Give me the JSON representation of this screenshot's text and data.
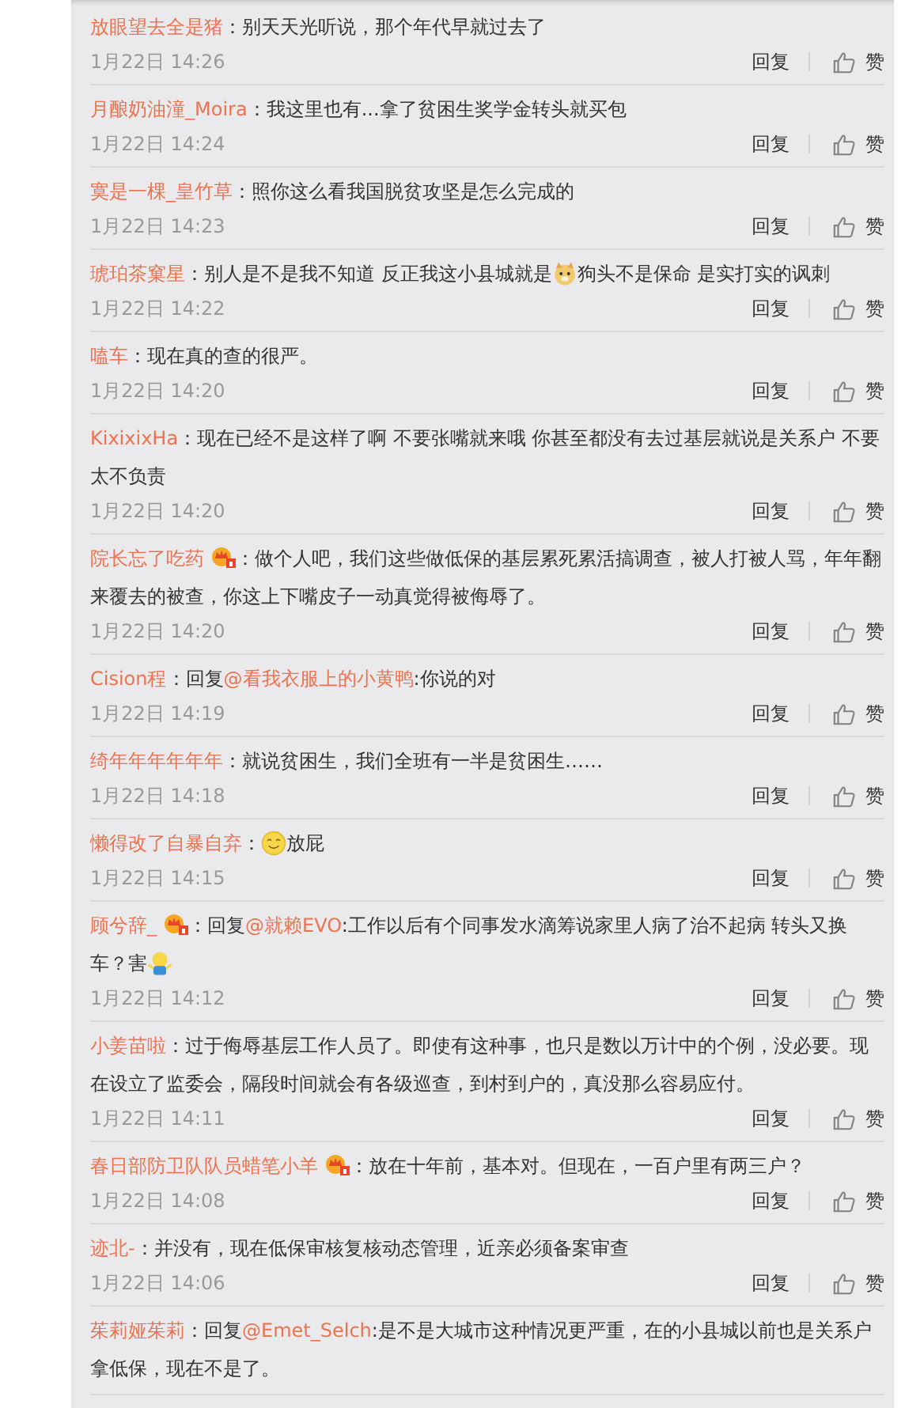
{
  "sep": "：",
  "comments": [
    {
      "name": "放眼望去全是猪",
      "badge": false,
      "content": [
        {
          "kind": "text",
          "text": "别天天光听说，那个年代早就过去了"
        }
      ],
      "time": "1月22日 14:26",
      "reply": "回复",
      "like": "赞"
    },
    {
      "name": "月酿奶油潼_Moira",
      "badge": false,
      "content": [
        {
          "kind": "text",
          "text": "我这里也有...拿了贫困生奖学金转头就买包"
        }
      ],
      "time": "1月22日 14:24",
      "reply": "回复",
      "like": "赞"
    },
    {
      "name": "寞是一棵_皇竹草",
      "badge": false,
      "content": [
        {
          "kind": "text",
          "text": "照你这么看我国脱贫攻坚是怎么完成的"
        }
      ],
      "time": "1月22日 14:23",
      "reply": "回复",
      "like": "赞"
    },
    {
      "name": "琥珀茶窠星",
      "badge": false,
      "content": [
        {
          "kind": "text",
          "text": "别人是不是我不知道 反正我这小县城就是"
        },
        {
          "kind": "dog_emoji"
        },
        {
          "kind": "text",
          "text": "狗头不是保命 是实打实的讽刺"
        }
      ],
      "time": "1月22日 14:22",
      "reply": "回复",
      "like": "赞"
    },
    {
      "name": "嗑车",
      "badge": false,
      "content": [
        {
          "kind": "text",
          "text": "现在真的查的很严。"
        }
      ],
      "time": "1月22日 14:20",
      "reply": "回复",
      "like": "赞"
    },
    {
      "name": "KixixixHa",
      "badge": false,
      "content": [
        {
          "kind": "text",
          "text": "现在已经不是这样了啊 不要张嘴就来哦 你甚至都没有去过基层就说是关系户 不要太不负责"
        }
      ],
      "time": "1月22日 14:20",
      "reply": "回复",
      "like": "赞"
    },
    {
      "name": "院长忘了吃药",
      "badge": true,
      "content": [
        {
          "kind": "text",
          "text": "做个人吧，我们这些做低保的基层累死累活搞调查，被人打被人骂，年年翻来覆去的被查，你这上下嘴皮子一动真觉得被侮辱了。"
        }
      ],
      "time": "1月22日 14:20",
      "reply": "回复",
      "like": "赞"
    },
    {
      "name": "Cision程",
      "badge": false,
      "content": [
        {
          "kind": "text",
          "text": "回复"
        },
        {
          "kind": "mention",
          "text": "@看我衣服上的小黄鸭"
        },
        {
          "kind": "text",
          "text": ":你说的对"
        }
      ],
      "time": "1月22日 14:19",
      "reply": "回复",
      "like": "赞"
    },
    {
      "name": "绮年年年年年年",
      "badge": false,
      "content": [
        {
          "kind": "text",
          "text": "就说贫困生，我们全班有一半是贫困生……"
        }
      ],
      "time": "1月22日 14:18",
      "reply": "回复",
      "like": "赞"
    },
    {
      "name": "懒得改了自暴自弃",
      "badge": false,
      "content": [
        {
          "kind": "smile_emoji"
        },
        {
          "kind": "text",
          "text": "放屁"
        }
      ],
      "time": "1月22日 14:15",
      "reply": "回复",
      "like": "赞"
    },
    {
      "name": "顾兮辞_",
      "badge": true,
      "content": [
        {
          "kind": "text",
          "text": "回复"
        },
        {
          "kind": "mention",
          "text": "@就赖EVO"
        },
        {
          "kind": "text",
          "text": ":工作以后有个同事发水滴筹说家里人病了治不起病 转头又换车？害"
        },
        {
          "kind": "shrug_emoji"
        }
      ],
      "time": "1月22日 14:12",
      "reply": "回复",
      "like": "赞"
    },
    {
      "name": "小姜苗啦",
      "badge": false,
      "content": [
        {
          "kind": "text",
          "text": "过于侮辱基层工作人员了。即使有这种事，也只是数以万计中的个例，没必要。现在设立了监委会，隔段时间就会有各级巡查，到村到户的，真没那么容易应付。"
        }
      ],
      "time": "1月22日 14:11",
      "reply": "回复",
      "like": "赞"
    },
    {
      "name": "春日部防卫队队员蜡笔小羊",
      "badge": true,
      "content": [
        {
          "kind": "text",
          "text": "放在十年前，基本对。但现在，一百户里有两三户？"
        }
      ],
      "time": "1月22日 14:08",
      "reply": "回复",
      "like": "赞"
    },
    {
      "name": "迹北-",
      "badge": false,
      "content": [
        {
          "kind": "text",
          "text": "并没有，现在低保审核复核动态管理，近亲必须备案审查"
        }
      ],
      "time": "1月22日 14:06",
      "reply": "回复",
      "like": "赞"
    },
    {
      "name": "茱莉娅茱莉",
      "badge": false,
      "content": [
        {
          "kind": "text",
          "text": "回复"
        },
        {
          "kind": "mention",
          "text": "@Emet_Selch"
        },
        {
          "kind": "text",
          "text": ":是不是大城市这种情况更严重，在的小县城以前也是关系户拿低保，现在不是了。"
        }
      ]
    }
  ]
}
